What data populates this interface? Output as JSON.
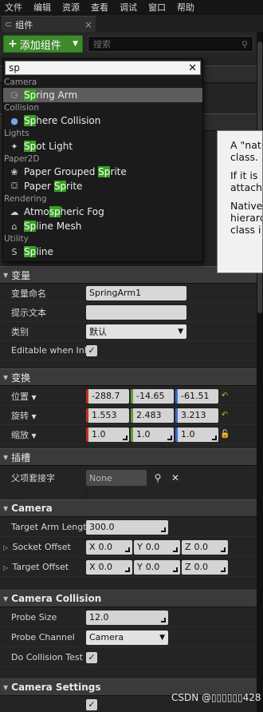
{
  "menu": [
    "文件",
    "编辑",
    "资源",
    "查看",
    "调试",
    "窗口",
    "帮助"
  ],
  "tab": {
    "title": "组件",
    "close": "×"
  },
  "toolbar": {
    "add_label": "添加组件",
    "search_placeholder": "搜索"
  },
  "dropdown": {
    "query": "sp",
    "groups": [
      {
        "category": "Camera",
        "items": [
          {
            "pre": "",
            "hl": "Sp",
            "post": "ring Arm",
            "icon": "spring-arm-icon",
            "selected": true
          }
        ]
      },
      {
        "category": "Collision",
        "items": [
          {
            "pre": "",
            "hl": "Sp",
            "post": "here Collision",
            "icon": "sphere-icon"
          }
        ]
      },
      {
        "category": "Lights",
        "items": [
          {
            "pre": "",
            "hl": "Sp",
            "post": "ot Light",
            "icon": "spot-light-icon"
          }
        ]
      },
      {
        "category": "Paper2D",
        "items": [
          {
            "pre": "Paper Grouped ",
            "hl": "Sp",
            "post": "rite",
            "icon": "grouped-sprite-icon"
          },
          {
            "pre": "Paper ",
            "hl": "Sp",
            "post": "rite",
            "icon": "sprite-icon"
          }
        ]
      },
      {
        "category": "Rendering",
        "items": [
          {
            "pre": "Atmo",
            "hl": "sp",
            "post": "heric Fog",
            "icon": "fog-icon"
          },
          {
            "pre": "",
            "hl": "Sp",
            "post": "line Mesh",
            "icon": "spline-mesh-icon"
          }
        ]
      },
      {
        "category": "Utility",
        "items": [
          {
            "pre": "",
            "hl": "Sp",
            "post": "line",
            "icon": "spline-icon"
          }
        ]
      }
    ]
  },
  "tooltip": {
    "lines": [
      "A \"nati",
      "class.",
      "If it is",
      "attach",
      "Native",
      "hierarc",
      "class i"
    ]
  },
  "variables": {
    "header": "变量",
    "name_label": "变量命名",
    "name_value": "SpringArm1",
    "tooltip_label": "提示文本",
    "tooltip_value": "",
    "category_label": "类别",
    "category_value": "默认",
    "editable_label": "Editable when Inhe"
  },
  "transform": {
    "header": "变换",
    "location_label": "位置",
    "location": [
      "-288.7",
      "-14.65",
      "-61.51"
    ],
    "rotation_label": "旋转",
    "rotation": [
      "1.553",
      "2.483",
      "3.213"
    ],
    "scale_label": "缩放",
    "scale": [
      "1.0",
      "1.0",
      "1.0"
    ]
  },
  "sockets": {
    "header": "插槽",
    "parent_label": "父项套接字",
    "parent_value": "None"
  },
  "camera": {
    "header": "Camera",
    "target_arm_label": "Target Arm Length",
    "target_arm_value": "300.0",
    "socket_offset_label": "Socket Offset",
    "socket_offset": [
      "0.0",
      "0.0",
      "0.0"
    ],
    "target_offset_label": "Target Offset",
    "target_offset": [
      "0.0",
      "0.0",
      "0.0"
    ],
    "axes": [
      "X",
      "Y",
      "Z"
    ]
  },
  "camera_collision": {
    "header": "Camera Collision",
    "probe_size_label": "Probe Size",
    "probe_size_value": "12.0",
    "probe_channel_label": "Probe Channel",
    "probe_channel_value": "Camera",
    "do_collision_label": "Do Collision Test"
  },
  "camera_settings": {
    "header": "Camera Settings"
  },
  "watermark": "CSDN @▯▯▯▯▯▯428",
  "colors": {
    "accent_green": "#3c8a2b",
    "highlight": "#35a41f",
    "x_axis": "#c0321f",
    "y_axis": "#5aa231",
    "z_axis": "#3a6bd8",
    "reset": "#d9a81d"
  }
}
